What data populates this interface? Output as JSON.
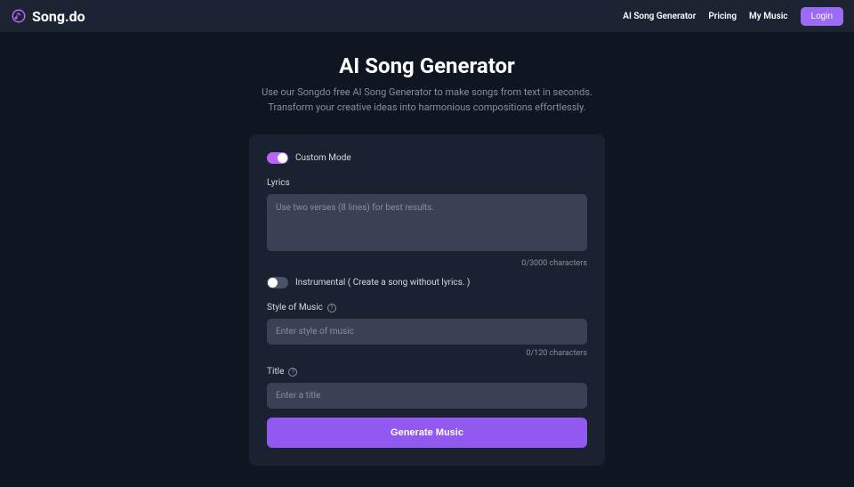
{
  "header": {
    "logo_text": "Song.do",
    "nav": {
      "ai_generator": "AI Song Generator",
      "pricing": "Pricing",
      "my_music": "My Music",
      "login": "Login"
    }
  },
  "main": {
    "title": "AI Song Generator",
    "subtitle_line1": "Use our Songdo free AI Song Generator to make songs from text in seconds.",
    "subtitle_line2": "Transform your creative ideas into harmonious compositions effortlessly."
  },
  "form": {
    "custom_mode_label": "Custom Mode",
    "lyrics_label": "Lyrics",
    "lyrics_placeholder": "Use two verses (8 lines) for best results.",
    "lyrics_count": "0/3000 characters",
    "instrumental_label": "Instrumental ( Create a song without lyrics. )",
    "style_label": "Style of Music",
    "style_placeholder": "Enter style of music",
    "style_count": "0/120 characters",
    "title_label": "Title",
    "title_placeholder": "Enter a title",
    "generate_button": "Generate Music"
  }
}
